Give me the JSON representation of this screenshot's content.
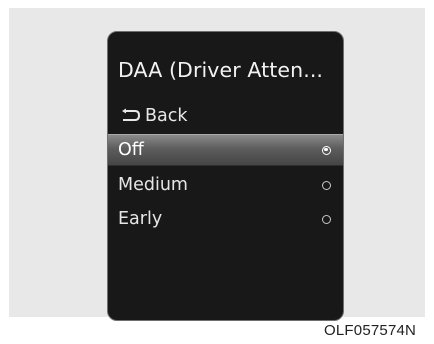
{
  "menu": {
    "title": "DAA (Driver Atten...",
    "back_label": "Back",
    "back_icon": "return-arrow-icon",
    "options": [
      {
        "label": "Off",
        "selected": true
      },
      {
        "label": "Medium",
        "selected": false
      },
      {
        "label": "Early",
        "selected": false
      }
    ]
  },
  "image_code": "OLF057574N",
  "colors": {
    "panel_background": "#181818",
    "selected_highlight": "#6a6a6a",
    "text": "#e6e6e6"
  }
}
